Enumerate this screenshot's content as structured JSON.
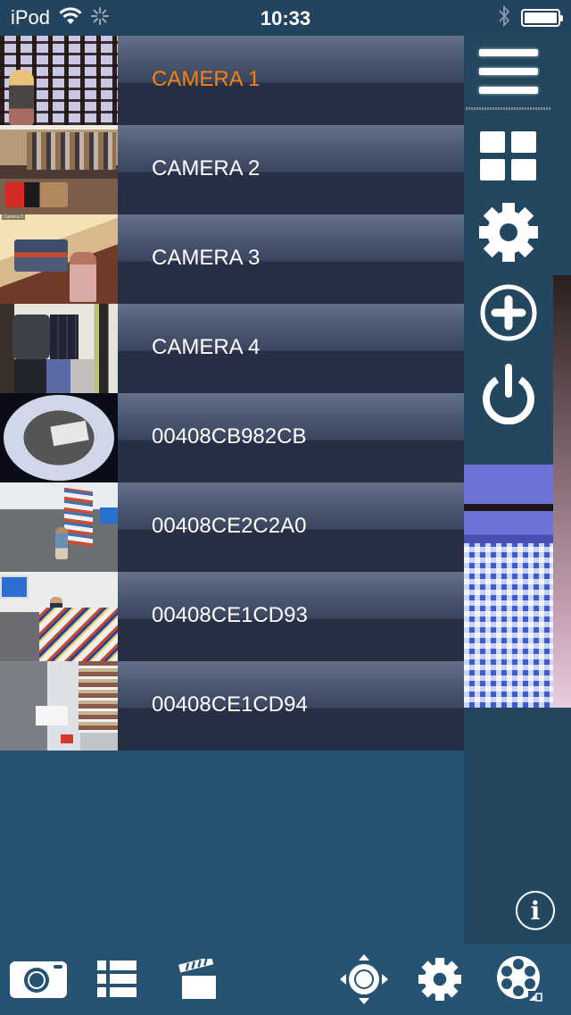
{
  "status_bar": {
    "carrier": "iPod",
    "time": "10:33",
    "icons": [
      "wifi-icon",
      "activity-spinner-icon",
      "bluetooth-icon",
      "battery-icon"
    ],
    "battery_percent": 100
  },
  "camera_list": {
    "active_color": "#f5820d",
    "items": [
      {
        "label": "CAMERA 1",
        "active": true
      },
      {
        "label": "CAMERA 2",
        "active": false
      },
      {
        "label": "CAMERA 3",
        "active": false,
        "thumbnail_overlay": "Camera 3"
      },
      {
        "label": "CAMERA 4",
        "active": false
      },
      {
        "label": "00408CB982CB",
        "active": false
      },
      {
        "label": "00408CE2C2A0",
        "active": false
      },
      {
        "label": "00408CE1CD93",
        "active": false
      },
      {
        "label": "00408CE1CD94",
        "active": false
      }
    ]
  },
  "side_menu": {
    "items": [
      {
        "icon": "hamburger-menu-icon"
      },
      {
        "icon": "grid-layout-icon"
      },
      {
        "icon": "gear-icon"
      },
      {
        "icon": "add-circle-icon"
      },
      {
        "icon": "power-icon"
      }
    ],
    "info_label": "i"
  },
  "toolbar": {
    "items": [
      {
        "icon": "camera-snapshot-icon"
      },
      {
        "icon": "list-icon"
      },
      {
        "icon": "clapperboard-icon"
      },
      {
        "icon": "ptz-joystick-icon"
      },
      {
        "icon": "gear-icon"
      },
      {
        "icon": "film-reel-icon"
      }
    ]
  },
  "colors": {
    "background": "#275373",
    "panel": "#23475f",
    "status_bar": "#22445f",
    "active_text": "#f5820d"
  }
}
